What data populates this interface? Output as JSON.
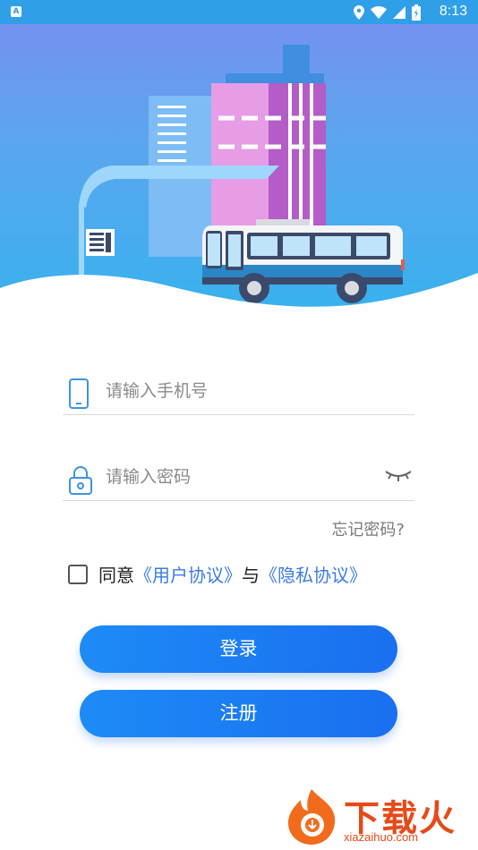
{
  "status_bar": {
    "time": "8:13",
    "app_indicator": "A"
  },
  "form": {
    "phone_placeholder": "请输入手机号",
    "password_placeholder": "请输入密码",
    "forgot_password": "忘记密码?"
  },
  "agreement": {
    "prefix": "同意",
    "user_agreement": "《用户协议》",
    "conjunction": "与",
    "privacy_policy": "《隐私协议》"
  },
  "buttons": {
    "login": "登录",
    "register": "注册"
  },
  "watermark": {
    "brand": "下载火",
    "url": "xiazaihuo.com"
  },
  "colors": {
    "primary": "#1a7cf3",
    "link": "#3b7ce3",
    "header_top": "#7a8ef0",
    "header_bottom": "#36b2ee"
  }
}
